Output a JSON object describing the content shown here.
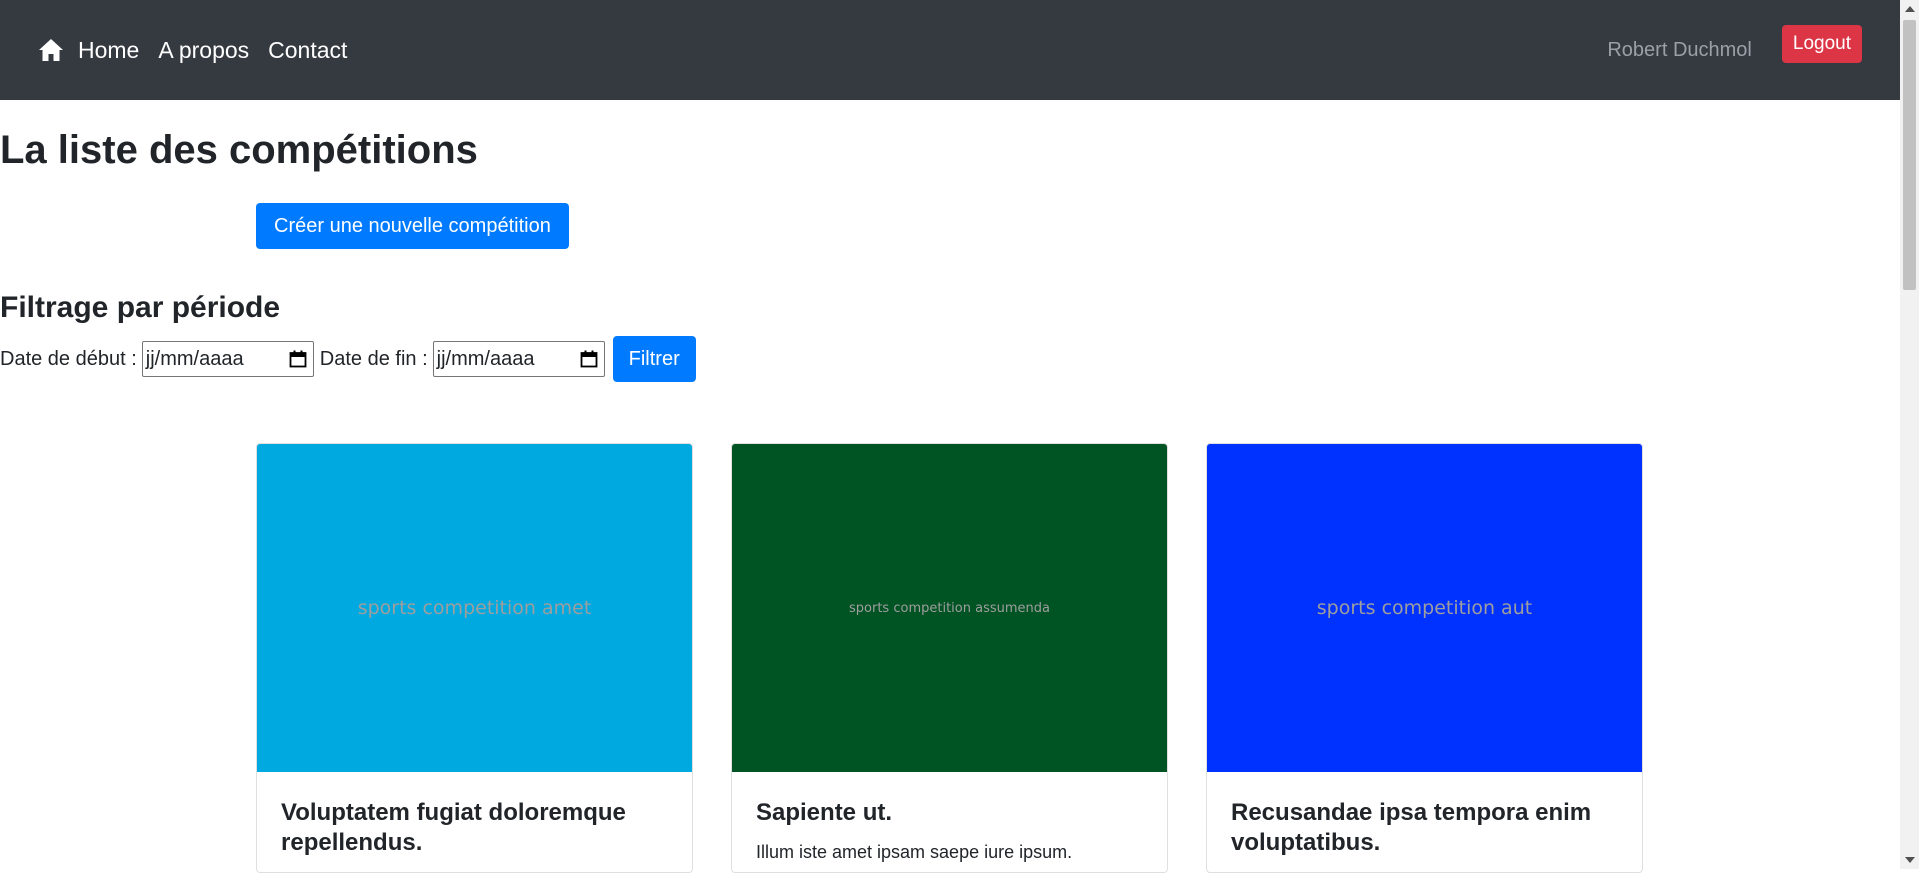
{
  "navbar": {
    "links": [
      "Home",
      "A propos",
      "Contact"
    ],
    "user_name": "Robert Duchmol",
    "logout_label": "Logout",
    "bg_color": "#343a40"
  },
  "main": {
    "title": "La liste des compétitions",
    "create_button_label": "Créer une nouvelle compétition",
    "filter": {
      "heading": "Filtrage par période",
      "start_label": "Date de début :",
      "start_placeholder": "jj/mm/aaaa",
      "end_label": "Date de fin :",
      "end_placeholder": "jj/mm/aaaa",
      "button_label": "Filtrer"
    }
  },
  "cards": [
    {
      "image_text": "sports competition amet",
      "image_color": "#00a9df",
      "title": "Voluptatem fugiat doloremque repellendus.",
      "text": ""
    },
    {
      "image_text": "sports competition assumenda",
      "image_color": "#005323",
      "title": "Sapiente ut.",
      "text": "Illum iste amet ipsam saepe iure ipsum."
    },
    {
      "image_text": "sports competition aut",
      "image_color": "#0032ff",
      "title": "Recusandae ipsa tempora enim voluptatibus.",
      "text": ""
    }
  ]
}
